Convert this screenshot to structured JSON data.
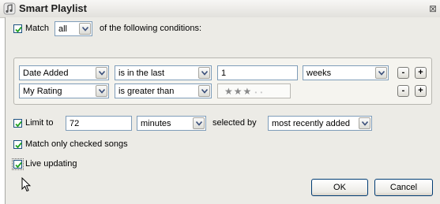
{
  "window": {
    "title": "Smart Playlist",
    "close_glyph": "⊠"
  },
  "match": {
    "label": "Match",
    "checked": true,
    "selector_value": "all",
    "suffix": "of the following conditions:"
  },
  "conditions": [
    {
      "field": "Date Added",
      "operator": "is in the last",
      "value": "1",
      "unit": "weeks",
      "remove_label": "-",
      "add_label": "+"
    },
    {
      "field": "My Rating",
      "operator": "is greater than",
      "rating_stars": 3,
      "rating_max": 5,
      "remove_label": "-",
      "add_label": "+"
    }
  ],
  "limit": {
    "label": "Limit to",
    "checked": true,
    "value": "72",
    "unit": "minutes",
    "selected_by_label": "selected by",
    "selected_by_value": "most recently added"
  },
  "match_checked_songs": {
    "label": "Match only checked songs",
    "checked": true
  },
  "live_updating": {
    "label": "Live updating",
    "checked": true
  },
  "buttons": {
    "ok": "OK",
    "cancel": "Cancel"
  },
  "icons": {
    "app": "music-note-icon",
    "cursor": "mouse-pointer-icon",
    "check": "check-icon",
    "dropdown": "chevron-down-icon"
  },
  "colors": {
    "checkbox_border": "#1c5180",
    "check_mark": "#21a121",
    "button_border": "#003c74",
    "field_border": "#7f9db9"
  }
}
